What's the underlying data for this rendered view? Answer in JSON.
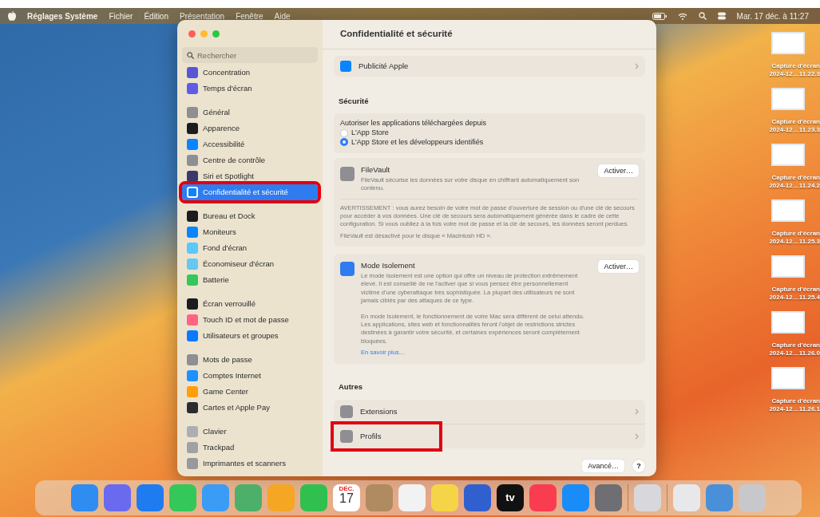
{
  "menubar": {
    "items": [
      {
        "label": "Réglages Système",
        "bold": true
      },
      {
        "label": "Fichier",
        "bold": false
      },
      {
        "label": "Édition",
        "bold": false
      },
      {
        "label": "Présentation",
        "bold": false
      },
      {
        "label": "Fenêtre",
        "bold": false
      },
      {
        "label": "Aide",
        "bold": false
      }
    ],
    "clock": "Mar. 17 déc. à 11:27"
  },
  "sidebar": {
    "search": {
      "placeholder": "Rechercher"
    },
    "groups": [
      [
        {
          "label": "Concentration",
          "color": "#5856d6",
          "selected": false,
          "highlighted": false
        },
        {
          "label": "Temps d'écran",
          "color": "#5e5ce6",
          "selected": false,
          "highlighted": false
        }
      ],
      [
        {
          "label": "Général",
          "color": "#8e8e93",
          "selected": false,
          "highlighted": false
        },
        {
          "label": "Apparence",
          "color": "#1c1c1e",
          "selected": false,
          "highlighted": false
        },
        {
          "label": "Accessibilité",
          "color": "#0a84ff",
          "selected": false,
          "highlighted": false
        },
        {
          "label": "Centre de contrôle",
          "color": "#8e8e93",
          "selected": false,
          "highlighted": false
        },
        {
          "label": "Siri et Spotlight",
          "color": "#3a3a6a",
          "selected": false,
          "highlighted": false
        },
        {
          "label": "Confidentialité et sécurité",
          "color": "#0a84ff",
          "selected": true,
          "highlighted": true
        }
      ],
      [
        {
          "label": "Bureau et Dock",
          "color": "#1c1c1e",
          "selected": false,
          "highlighted": false
        },
        {
          "label": "Moniteurs",
          "color": "#0a84ff",
          "selected": false,
          "highlighted": false
        },
        {
          "label": "Fond d'écran",
          "color": "#5ac8fa",
          "selected": false,
          "highlighted": false
        },
        {
          "label": "Économiseur d'écran",
          "color": "#64c8f0",
          "selected": false,
          "highlighted": false
        },
        {
          "label": "Batterie",
          "color": "#34c759",
          "selected": false,
          "highlighted": false
        }
      ],
      [
        {
          "label": "Écran verrouillé",
          "color": "#1c1c1e",
          "selected": false,
          "highlighted": false
        },
        {
          "label": "Touch ID et mot de passe",
          "color": "#ff6482",
          "selected": false,
          "highlighted": false
        },
        {
          "label": "Utilisateurs et groupes",
          "color": "#0a7aff",
          "selected": false,
          "highlighted": false
        }
      ],
      [
        {
          "label": "Mots de passe",
          "color": "#8e8e93",
          "selected": false,
          "highlighted": false
        },
        {
          "label": "Comptes Internet",
          "color": "#1e90ff",
          "selected": false,
          "highlighted": false
        },
        {
          "label": "Game Center",
          "color": "#ff9f0a",
          "selected": false,
          "highlighted": false
        },
        {
          "label": "Cartes et Apple Pay",
          "color": "#2c2c2e",
          "selected": false,
          "highlighted": false
        }
      ],
      [
        {
          "label": "Clavier",
          "color": "#aeaeb2",
          "selected": false,
          "highlighted": false
        },
        {
          "label": "Trackpad",
          "color": "#a0a0a6",
          "selected": false,
          "highlighted": false
        },
        {
          "label": "Imprimantes et scanners",
          "color": "#98989d",
          "selected": false,
          "highlighted": false
        }
      ]
    ]
  },
  "content": {
    "title": "Confidentialité et sécurité",
    "top_row": {
      "label": "Publicité Apple",
      "color": "#0a84ff"
    },
    "security": {
      "heading": "Sécurité",
      "allow_label": "Autoriser les applications téléchargées depuis",
      "options": [
        {
          "label": "L'App Store",
          "selected": false
        },
        {
          "label": "L'App Store et les développeurs identifiés",
          "selected": true
        }
      ]
    },
    "filevault": {
      "title": "FileVault",
      "description": "FileVault sécurise les données sur votre disque en chiffrant automatiquement son contenu.",
      "button": "Activer…",
      "warning": "AVERTISSEMENT : vous aurez besoin de votre mot de passe d'ouverture de session ou d'une clé de secours pour accéder à vos données. Une clé de secours sera automatiquement générée dans le cadre de cette configuration. Si vous oubliez à la fois votre mot de passe et la clé de secours, les données seront perdues.",
      "status": "FileVault est désactivé pour le disque « Macintosh HD »."
    },
    "lockdown": {
      "title": "Mode Isolement",
      "paragraphs": [
        "Le mode Isolement est une option qui offre un niveau de protection extrêmement élevé. Il est conseillé de ne l'activer que si vous pensez être personnellement victime d'une cyberattaque très sophistiquée. La plupart des utilisateurs ne sont jamais ciblés par des attaques de ce type.",
        "En mode Isolement, le fonctionnement de votre Mac sera différent de celui attendu. Les applications, sites web et fonctionnalités feront l'objet de restrictions strictes destinées à garantir votre sécurité, et certaines expériences seront complètement bloquées."
      ],
      "link": "En savoir plus…",
      "button": "Activer…"
    },
    "others": {
      "heading": "Autres",
      "items": [
        {
          "label": "Extensions",
          "highlighted": false
        },
        {
          "label": "Profils",
          "highlighted": true
        }
      ]
    },
    "footer": {
      "advanced_button": "Avancé…",
      "help_button": "?"
    }
  },
  "desktop_files": [
    {
      "name": "Capture d'écran",
      "date": "2024-12…11.22.3"
    },
    {
      "name": "Capture d'écran",
      "date": "2024-12…11.23.3"
    },
    {
      "name": "Capture d'écran",
      "date": "2024-12…11.24.2"
    },
    {
      "name": "Capture d'écran",
      "date": "2024-12…11.25.3"
    },
    {
      "name": "Capture d'écran",
      "date": "2024-12…11.25.4"
    },
    {
      "name": "Capture d'écran",
      "date": "2024-12…11.26.0"
    },
    {
      "name": "Capture d'écran",
      "date": "2024-12…11.26.1"
    }
  ],
  "dock": [
    {
      "kind": "app",
      "color": "#2f8cf0"
    },
    {
      "kind": "app",
      "color": "#6a6af0"
    },
    {
      "kind": "app",
      "color": "#1e7cf0"
    },
    {
      "kind": "app",
      "color": "#34c759"
    },
    {
      "kind": "app",
      "color": "#3a9cf5"
    },
    {
      "kind": "app",
      "color": "#4cb06a"
    },
    {
      "kind": "app",
      "color": "#f5a623"
    },
    {
      "kind": "app",
      "color": "#30c050"
    },
    {
      "kind": "calendar",
      "month": "DÉC.",
      "day": "17"
    },
    {
      "kind": "app",
      "color": "#b08a60"
    },
    {
      "kind": "app",
      "color": "#f2f2f2"
    },
    {
      "kind": "app",
      "color": "#f5d547"
    },
    {
      "kind": "app",
      "color": "#3060d0"
    },
    {
      "kind": "tv",
      "label": "tv"
    },
    {
      "kind": "app",
      "color": "#fa3c50"
    },
    {
      "kind": "app",
      "color": "#1a8cf8"
    },
    {
      "kind": "app",
      "color": "#6e6e73"
    },
    {
      "kind": "separator"
    },
    {
      "kind": "app",
      "color": "#d8d8dc"
    },
    {
      "kind": "separator"
    },
    {
      "kind": "app",
      "color": "#e8e8ea"
    },
    {
      "kind": "app",
      "color": "#4a90d9"
    },
    {
      "kind": "app",
      "color": "#c8c8cc"
    }
  ]
}
